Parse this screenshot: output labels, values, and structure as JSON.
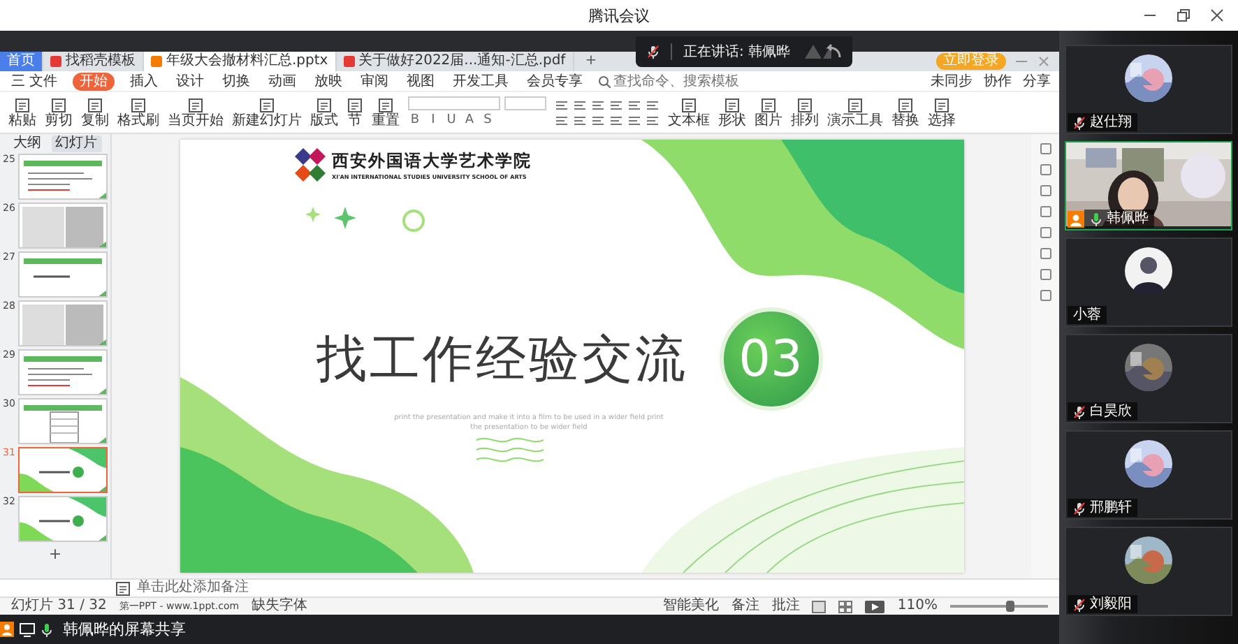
{
  "window": {
    "title": "腾讯会议"
  },
  "speaking_banner": {
    "text": "正在讲话: 韩佩晔"
  },
  "wps": {
    "tabs": [
      {
        "label": "首页",
        "kind": "home",
        "selected": false
      },
      {
        "label": "找稻壳模板",
        "kind": "docer",
        "selected": false
      },
      {
        "label": "年级大会撤材料汇总.pptx",
        "kind": "ppt",
        "selected": true
      },
      {
        "label": "关于做好2022届...通知-汇总.pdf",
        "kind": "pdf",
        "selected": false
      }
    ],
    "new_tab": "+",
    "login_badge": "立即登录",
    "menu": [
      {
        "label": "三 文件",
        "selected": false
      },
      {
        "label": "开始",
        "selected": true
      },
      {
        "label": "插入",
        "selected": false
      },
      {
        "label": "设计",
        "selected": false
      },
      {
        "label": "切换",
        "selected": false
      },
      {
        "label": "动画",
        "selected": false
      },
      {
        "label": "放映",
        "selected": false
      },
      {
        "label": "审阅",
        "selected": false
      },
      {
        "label": "视图",
        "selected": false
      },
      {
        "label": "开发工具",
        "selected": false
      },
      {
        "label": "会员专享",
        "selected": false
      }
    ],
    "search": {
      "placeholder": "查找命令、搜索模板"
    },
    "share_actions": [
      "未同步",
      "协作",
      "分享"
    ],
    "ribbon_left": [
      "粘贴",
      "剪切",
      "复制",
      "格式刷",
      "当页开始",
      "新建幻灯片",
      "版式",
      "节",
      "重置"
    ],
    "format_buttons": [
      "B",
      "I",
      "U",
      "A",
      "S"
    ],
    "ribbon_right": [
      "文本框",
      "形状",
      "图片",
      "排列",
      "演示工具",
      "替换",
      "选择"
    ],
    "panel_tabs": [
      {
        "label": "大纲",
        "selected": false
      },
      {
        "label": "幻灯片",
        "selected": true
      }
    ],
    "thumbnails": [
      {
        "number": "25",
        "kind": "text",
        "selected": false
      },
      {
        "number": "26",
        "kind": "scan",
        "selected": false
      },
      {
        "number": "27",
        "kind": "heading",
        "selected": false
      },
      {
        "number": "28",
        "kind": "scan",
        "selected": false
      },
      {
        "number": "29",
        "kind": "text",
        "selected": false
      },
      {
        "number": "30",
        "kind": "table",
        "selected": false
      },
      {
        "number": "31",
        "kind": "cover",
        "selected": true
      },
      {
        "number": "32",
        "kind": "cover",
        "selected": false
      }
    ],
    "add_slide": "+",
    "slide": {
      "logo_text": "西安外国语大学艺术学院",
      "logo_subtext": "XI'AN INTERNATIONAL STUDIES UNIVERSITY SCHOOL OF ARTS",
      "title": "找工作经验交流",
      "number": "03",
      "subtitle": "print the presentation and make it into a film to be used in a wider field print the presentation to be wider field"
    },
    "notes_placeholder": "单击此处添加备注",
    "status": {
      "slide_count": "幻灯片 31 / 32",
      "theme": "第一PPT - www.1ppt.com",
      "missing_font": "缺失字体",
      "beautify": "智能美化",
      "notes": "备注",
      "comments": "批注",
      "zoom": "110%"
    },
    "zoom_slider": {
      "level": 0.62
    }
  },
  "share_bar": {
    "text": "韩佩晔的屏幕共享"
  },
  "participants": [
    {
      "name": "赵仕翔",
      "muted": true,
      "speaking": false,
      "host": false,
      "kind": "picture"
    },
    {
      "name": "韩佩晔",
      "muted": false,
      "speaking": true,
      "host": true,
      "kind": "video"
    },
    {
      "name": "小蓉",
      "muted": false,
      "speaking": false,
      "host": false,
      "kind": "person"
    },
    {
      "name": "白昊欣",
      "muted": true,
      "speaking": false,
      "host": false,
      "kind": "picture"
    },
    {
      "name": "邢鹏轩",
      "muted": true,
      "speaking": false,
      "host": false,
      "kind": "picture"
    },
    {
      "name": "刘毅阳",
      "muted": true,
      "speaking": false,
      "host": false,
      "kind": "picture"
    }
  ]
}
